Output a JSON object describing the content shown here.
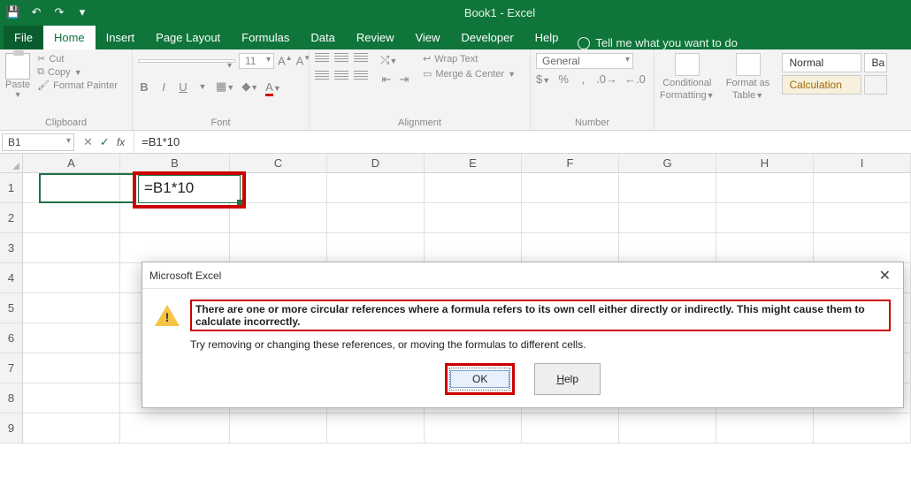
{
  "titlebar": {
    "title": "Book1 - Excel"
  },
  "tabs": {
    "file": "File",
    "home": "Home",
    "insert": "Insert",
    "page_layout": "Page Layout",
    "formulas": "Formulas",
    "data": "Data",
    "review": "Review",
    "view": "View",
    "developer": "Developer",
    "help": "Help",
    "tell_me": "Tell me what you want to do"
  },
  "ribbon": {
    "clipboard": {
      "paste": "Paste",
      "cut": "Cut",
      "copy": "Copy",
      "format_painter": "Format Painter",
      "label": "Clipboard"
    },
    "font": {
      "name": " ",
      "size": "11",
      "bold": "B",
      "italic": "I",
      "underline": "U",
      "label": "Font"
    },
    "alignment": {
      "wrap": "Wrap Text",
      "merge": "Merge & Center",
      "label": "Alignment"
    },
    "number": {
      "format": "General",
      "label": "Number"
    },
    "styles": {
      "cond": "Conditional Formatting",
      "cond1": "Conditional",
      "cond2": "Formatting",
      "table": "Format as Table",
      "table1": "Format as",
      "table2": "Table",
      "normal": "Normal",
      "bad": "Ba",
      "calculation": "Calculation"
    }
  },
  "formula_bar": {
    "name_box": "B1",
    "formula": "=B1*10"
  },
  "grid": {
    "columns": [
      "A",
      "B",
      "C",
      "D",
      "E",
      "F",
      "G",
      "H",
      "I"
    ],
    "rows": [
      "1",
      "2",
      "3",
      "4",
      "5",
      "6",
      "7",
      "8",
      "9"
    ],
    "b1_value": "=B1*10"
  },
  "dialog": {
    "title": "Microsoft Excel",
    "msg1": "There are one or more circular references where a formula refers to its own cell either directly or indirectly. This might cause them to calculate incorrectly.",
    "msg2": "Try removing or changing these references, or moving the formulas to different cells.",
    "ok": "OK",
    "help": "Help"
  }
}
